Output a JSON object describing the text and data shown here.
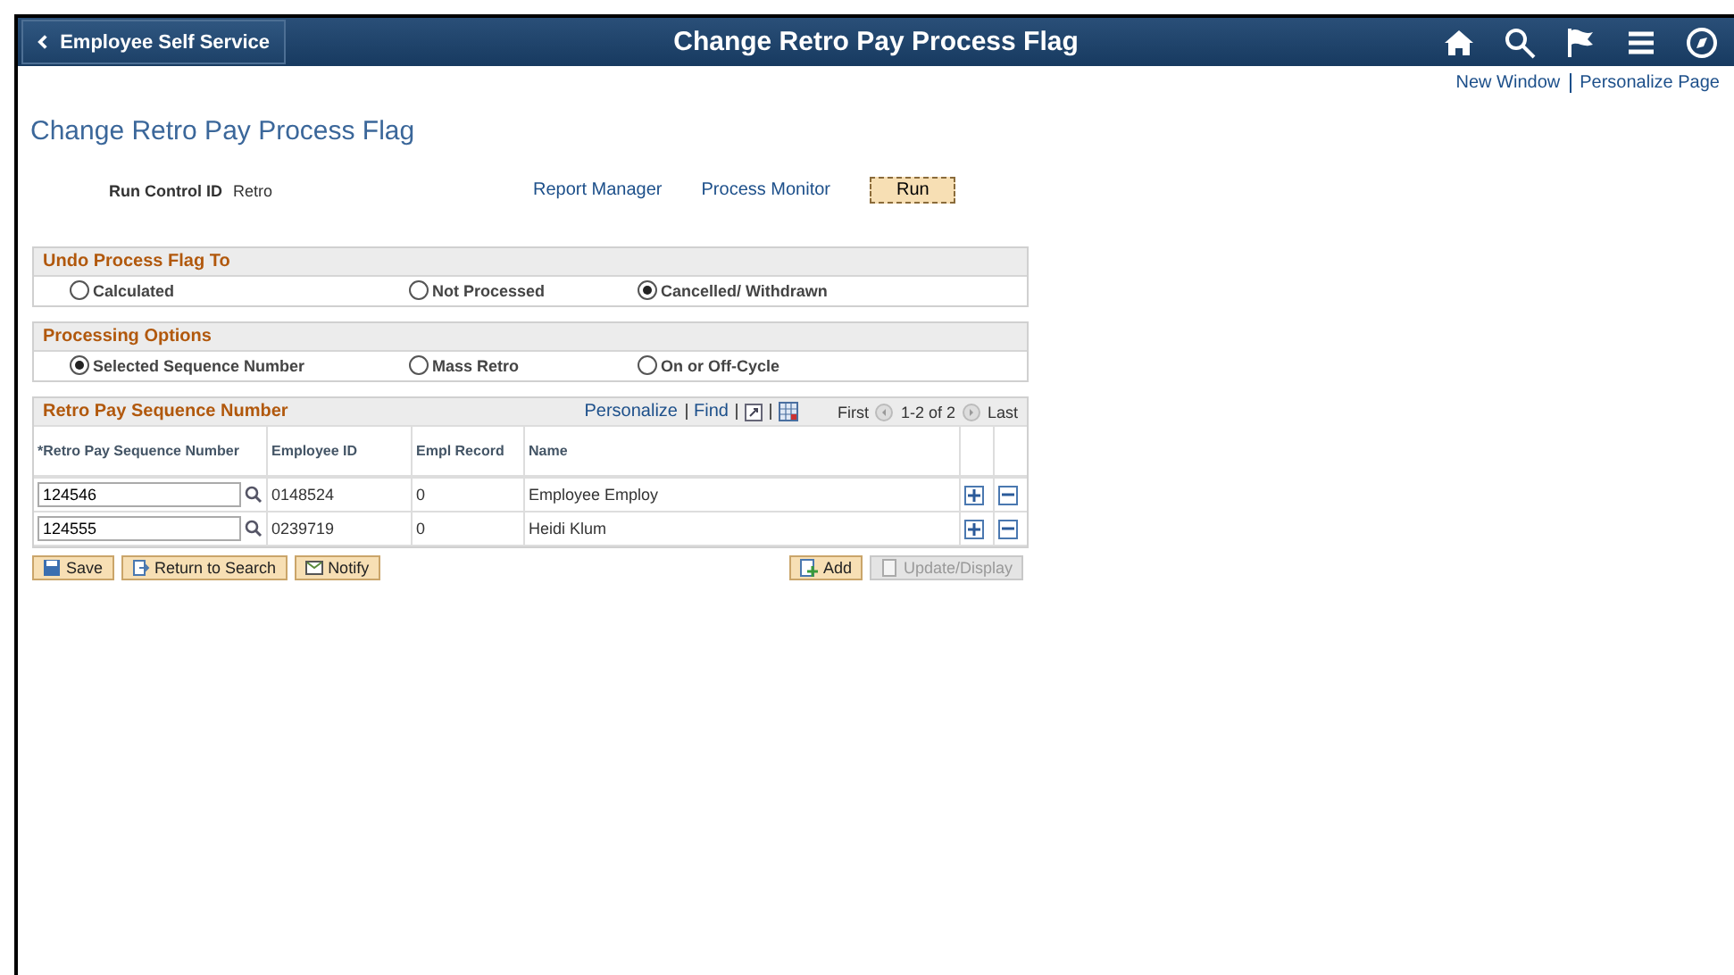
{
  "header": {
    "back_label": "Employee Self Service",
    "title": "Change Retro Pay Process Flag"
  },
  "top_links": [
    "New Window",
    "Personalize Page"
  ],
  "page_title": "Change Retro Pay Process Flag",
  "run_control": {
    "label": "Run Control ID",
    "value": "Retro",
    "links": [
      "Report Manager",
      "Process Monitor"
    ],
    "run_button": "Run"
  },
  "groups": [
    {
      "title": "Undo Process Flag To",
      "options": [
        {
          "label": "Calculated",
          "selected": false
        },
        {
          "label": "Not Processed",
          "selected": false
        },
        {
          "label": "Cancelled/ Withdrawn",
          "selected": true
        }
      ]
    },
    {
      "title": "Processing Options",
      "options": [
        {
          "label": "Selected Sequence Number",
          "selected": true
        },
        {
          "label": "Mass Retro",
          "selected": false
        },
        {
          "label": "On or Off-Cycle",
          "selected": false
        }
      ]
    }
  ],
  "grid": {
    "title": "Retro Pay Sequence Number",
    "tools": [
      "Personalize",
      "Find"
    ],
    "nav": {
      "first": "First",
      "range": "1-2 of 2",
      "last": "Last"
    },
    "columns": [
      "*Retro Pay Sequence Number",
      "Employee ID",
      "Empl Record",
      "Name"
    ],
    "rows": [
      {
        "sequence": "124546",
        "employee_id": "0148524",
        "empl_record": "0",
        "name": "Employee Employ"
      },
      {
        "sequence": "124555",
        "employee_id": "0239719",
        "empl_record": "0",
        "name": "Heidi Klum"
      }
    ]
  },
  "footer_buttons": [
    {
      "label": "Save",
      "kind": "save",
      "disabled": false
    },
    {
      "label": "Return to Search",
      "kind": "return",
      "disabled": false
    },
    {
      "label": "Notify",
      "kind": "notify",
      "disabled": false
    }
  ],
  "right_buttons": [
    {
      "label": "Add",
      "kind": "add",
      "disabled": false
    },
    {
      "label": "Update/Display",
      "kind": "update",
      "disabled": true
    }
  ]
}
